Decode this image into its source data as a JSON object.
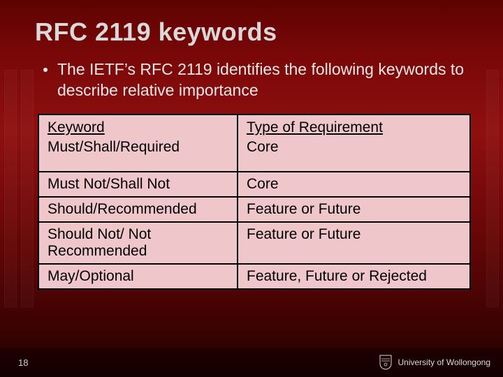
{
  "slide": {
    "title": "RFC 2119 keywords",
    "bullet": "The IETF’s RFC 2119 identifies the following keywords to describe relative importance",
    "page_number": "18"
  },
  "table": {
    "headers": {
      "keyword": "Keyword",
      "type": "Type of Requirement"
    },
    "rows": [
      {
        "keyword": "Must/Shall/Required",
        "type": "Core"
      },
      {
        "keyword": "Must Not/Shall Not",
        "type": "Core"
      },
      {
        "keyword": "Should/Recommended",
        "type": "Feature or Future"
      },
      {
        "keyword": "Should Not/ Not Recommended",
        "type": "Feature or Future"
      },
      {
        "keyword": "May/Optional",
        "type": "Feature, Future or Rejected"
      }
    ]
  },
  "footer": {
    "brand_text": "University of Wollongong"
  },
  "colors": {
    "table_fill": "#efc7cb",
    "bg_top": "#7a0808",
    "bg_bottom": "#1f0000",
    "text_light": "#d9d9d9"
  }
}
